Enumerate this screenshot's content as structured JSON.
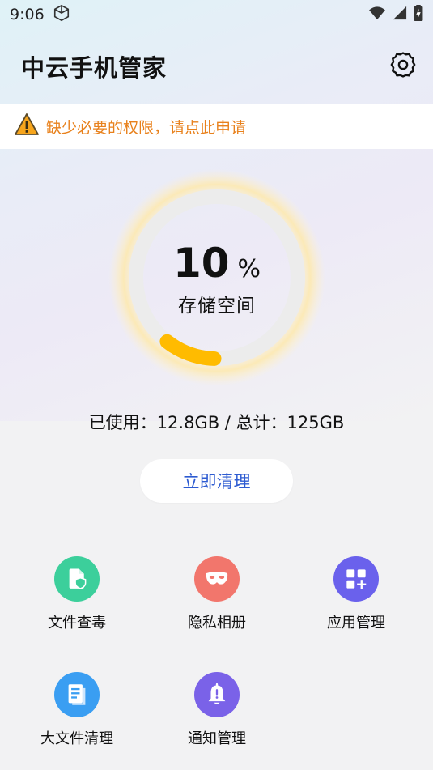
{
  "status_bar": {
    "time": "9:06"
  },
  "header": {
    "title": "中云手机管家"
  },
  "warning": {
    "text": "缺少必要的权限，请点此申请"
  },
  "storage": {
    "percent": "10",
    "percent_sign": "%",
    "label": "存储空间",
    "usage_text": "已使用：12.8GB / 总计：125GB",
    "used_fraction": 0.1
  },
  "clean_button": {
    "label": "立即清理"
  },
  "tools": [
    {
      "label": "文件查毒",
      "icon": "file-shield-icon",
      "color": "#3ccf9b"
    },
    {
      "label": "隐私相册",
      "icon": "privacy-mask-icon",
      "color": "#f2766c"
    },
    {
      "label": "应用管理",
      "icon": "app-grid-icon",
      "color": "#6a61ec"
    },
    {
      "label": "大文件清理",
      "icon": "document-icon",
      "color": "#3a9ef2"
    },
    {
      "label": "通知管理",
      "icon": "bell-icon",
      "color": "#7a62e8"
    }
  ],
  "colors": {
    "gauge_progress": "#ffbb00",
    "warning": "#e8811c",
    "accent": "#2d5bd1"
  }
}
